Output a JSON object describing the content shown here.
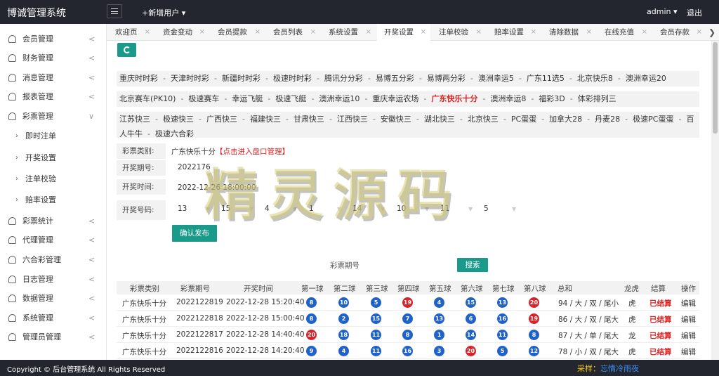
{
  "header": {
    "brand": "博诚管理系统",
    "add_user": "+新增用户 ▾",
    "user": "admin ▾",
    "logout": "退出"
  },
  "sidebar": {
    "items": [
      {
        "label": "会员管理",
        "arrow": "<"
      },
      {
        "label": "财务管理",
        "arrow": "<"
      },
      {
        "label": "消息管理",
        "arrow": "<"
      },
      {
        "label": "报表管理",
        "arrow": "<"
      },
      {
        "label": "彩票管理",
        "arrow": "∨"
      },
      {
        "label": "即时注单"
      },
      {
        "label": "开奖设置"
      },
      {
        "label": "注单校验"
      },
      {
        "label": "赔率设置"
      },
      {
        "label": "彩票统计",
        "arrow": "<"
      },
      {
        "label": "代理管理",
        "arrow": "<"
      },
      {
        "label": "六合彩管理",
        "arrow": "<"
      },
      {
        "label": "日志管理",
        "arrow": "<"
      },
      {
        "label": "数据管理",
        "arrow": "<"
      },
      {
        "label": "系统管理",
        "arrow": "<"
      },
      {
        "label": "管理员管理",
        "arrow": "<"
      }
    ]
  },
  "tabs": [
    "欢迎页",
    "资金变动",
    "会员提款",
    "会员列表",
    "系统设置",
    "开奖设置",
    "注单校验",
    "赔率设置",
    "清除数据",
    "在线充值",
    "会员存款"
  ],
  "active_tab": "开奖设置",
  "lottery_rows": [
    [
      "重庆时时彩",
      "天津时时彩",
      "新疆时时彩",
      "极速时时彩",
      "腾讯分分彩",
      "易博五分彩",
      "易博两分彩",
      "澳洲幸运5",
      "广东11选5",
      "北京快乐8",
      "澳洲幸运20"
    ],
    [
      "北京赛车(PK10)",
      "极速赛车",
      "幸运飞艇",
      "极速飞艇",
      "澳洲幸运10",
      "重庆幸运农场",
      "广东快乐十分",
      "澳洲幸运8",
      "福彩3D",
      "体彩排列三"
    ],
    [
      "江苏快三",
      "极速快三",
      "广西快三",
      "福建快三",
      "甘肃快三",
      "江西快三",
      "安徽快三",
      "湖北快三",
      "北京快三",
      "PC蛋蛋",
      "加拿大28",
      "丹麦28",
      "极速PC蛋蛋",
      "百人牛牛",
      "极速六合彩"
    ]
  ],
  "separator": "-",
  "form": {
    "type_label": "彩票类别:",
    "type_value": "广东快乐十分",
    "type_link": "【点击进入盘口管理】",
    "period_label": "开奖期号:",
    "period_value": "2022176",
    "time_label": "开奖时间:",
    "time_value": "2022-12-26 18:00:00",
    "numbers_label": "开奖号码:",
    "numbers": [
      "13",
      "15",
      "4",
      "1",
      "14",
      "10",
      "11",
      "5"
    ],
    "publish_button": "确认发布"
  },
  "search": {
    "label": "彩票期号",
    "button": "搜索"
  },
  "table": {
    "headers": [
      "彩票类别",
      "彩票期号",
      "开奖时间",
      "第一球",
      "第二球",
      "第三球",
      "第四球",
      "第五球",
      "第六球",
      "第七球",
      "第八球",
      "总和",
      "龙虎",
      "结算",
      "操作"
    ],
    "rows": [
      {
        "type": "广东快乐十分",
        "period": "2022122819",
        "time": "2022-12-28 15:20:40",
        "balls": [
          "8",
          "10",
          "5",
          "19",
          "4",
          "15",
          "13",
          "20"
        ],
        "sum": "94 / 大 / 双 / 尾小",
        "dragon": "虎",
        "status": "已结算",
        "action": "编辑"
      },
      {
        "type": "广东快乐十分",
        "period": "2022122818",
        "time": "2022-12-28 15:00:40",
        "balls": [
          "8",
          "2",
          "15",
          "7",
          "13",
          "6",
          "16",
          "19"
        ],
        "sum": "86 / 大 / 双 / 尾大",
        "dragon": "虎",
        "status": "已结算",
        "action": "编辑"
      },
      {
        "type": "广东快乐十分",
        "period": "2022122817",
        "time": "2022-12-28 14:40:40",
        "balls": [
          "20",
          "18",
          "11",
          "8",
          "1",
          "14",
          "11",
          "8"
        ],
        "sum": "87 / 大 / 单 / 尾大",
        "dragon": "龙",
        "status": "已结算",
        "action": "编辑"
      },
      {
        "type": "广东快乐十分",
        "period": "2022122816",
        "time": "2022-12-28 14:20:40",
        "balls": [
          "9",
          "4",
          "11",
          "16",
          "3",
          "20",
          "5",
          "12"
        ],
        "sum": "78 / 小 / 双 / 尾大",
        "dragon": "虎",
        "status": "已结算",
        "action": "编辑"
      }
    ]
  },
  "footer": {
    "copyright": "Copyright © 后台管理系统 All Rights Reserved",
    "note_prefix": "采样：",
    "note_name": "忘情冷雨夜"
  },
  "watermark": "精灵源码",
  "colors": {
    "accent": "#1a9a8a",
    "topbar": "#23262e",
    "red": "#e02020",
    "ball_blue": "#1f62c9",
    "ball_red": "#d8232a"
  }
}
